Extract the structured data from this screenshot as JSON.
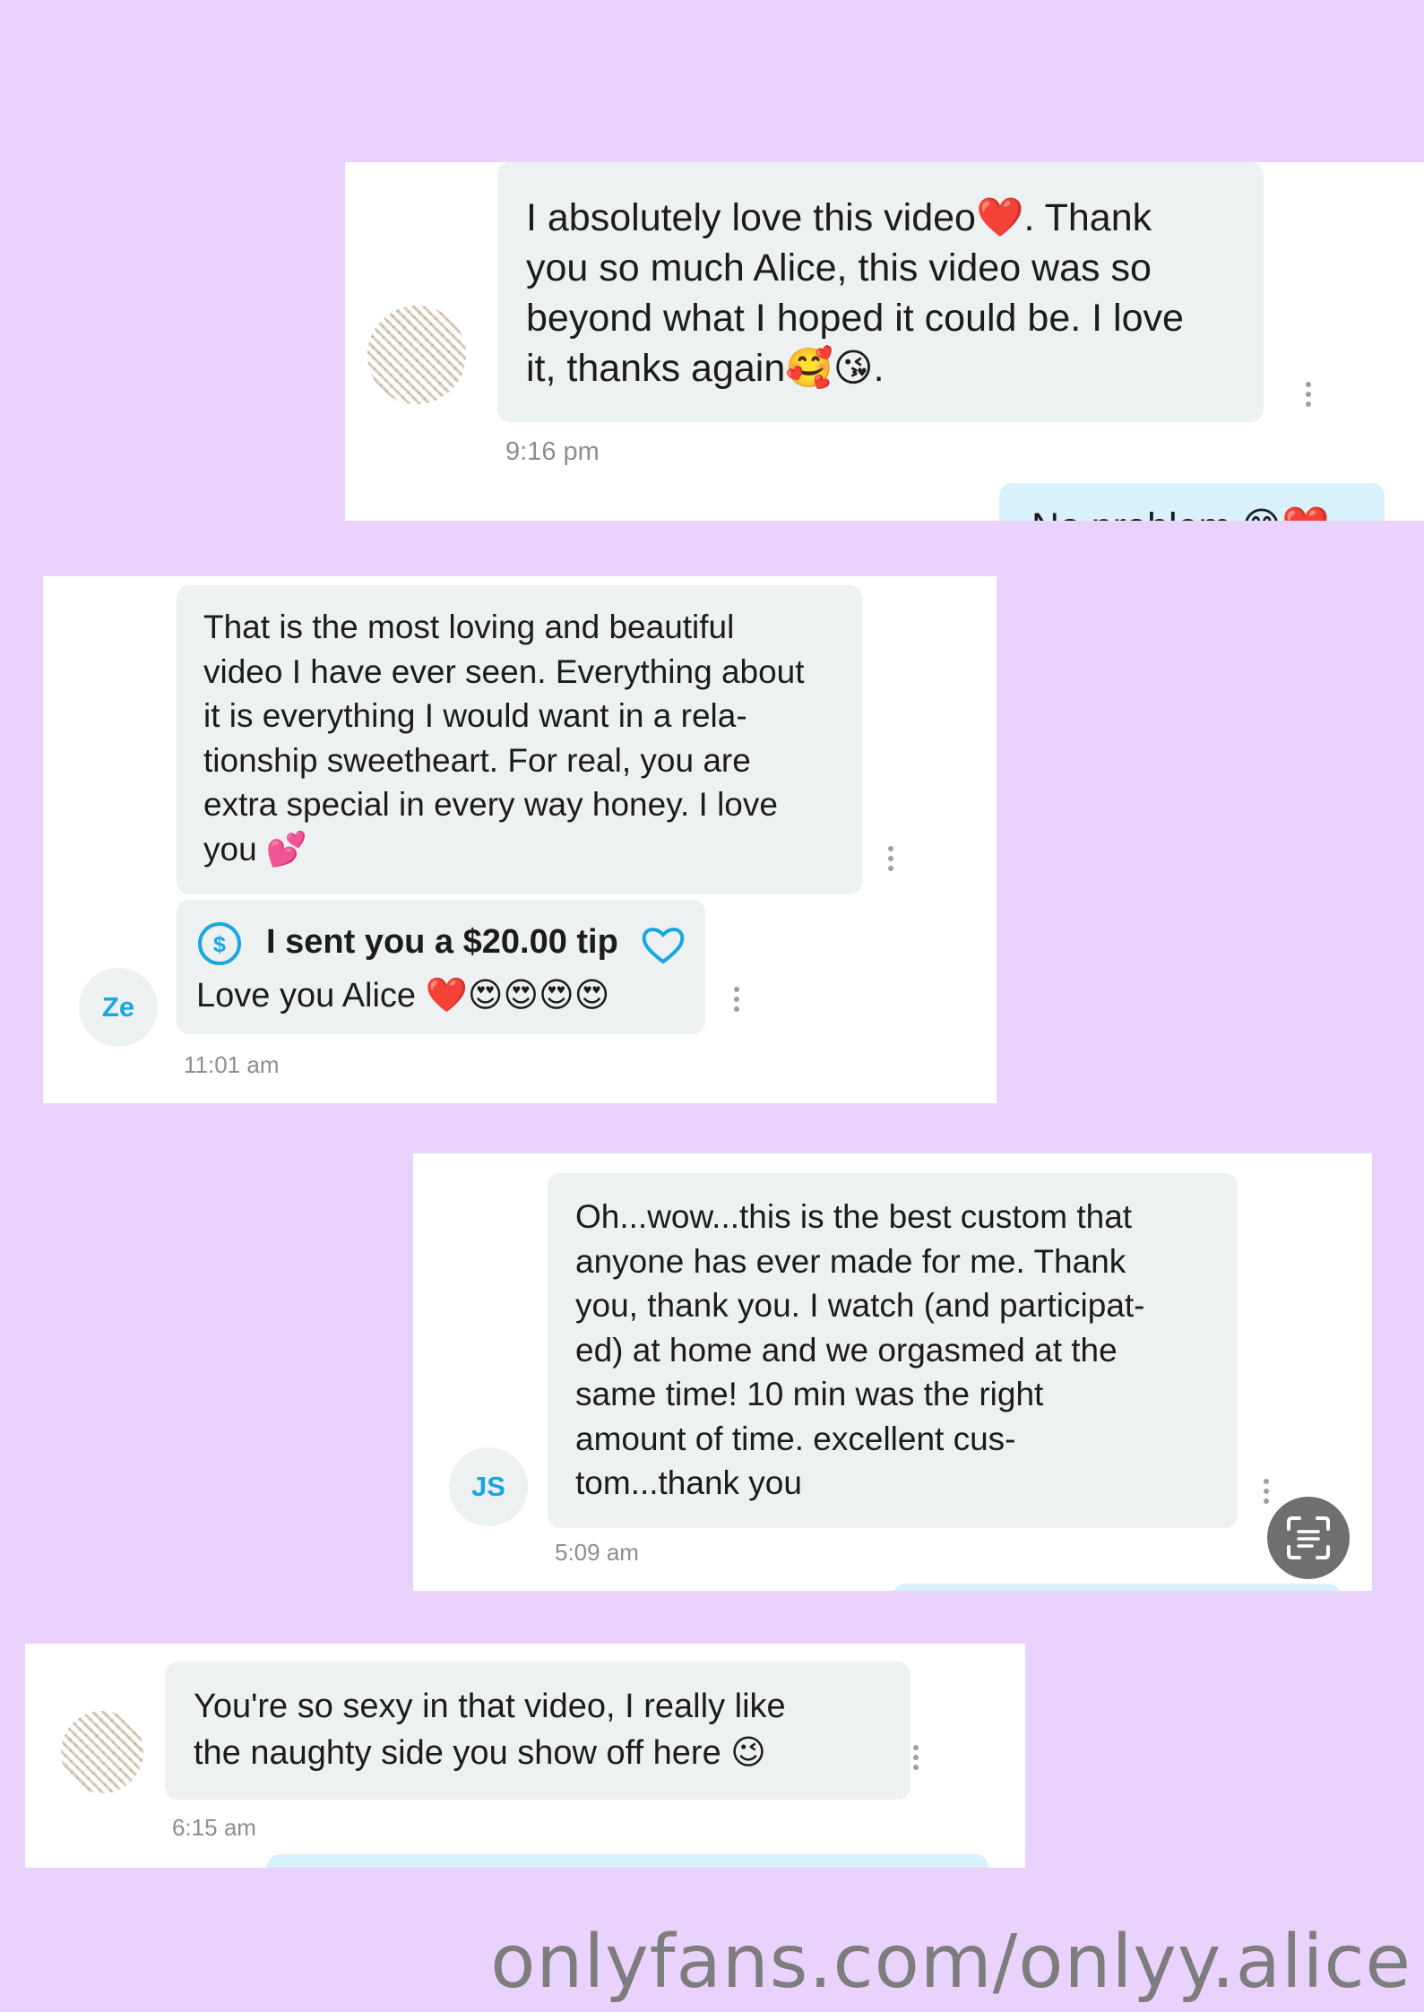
{
  "colors": {
    "background": "#e9d3fc",
    "bubble": "#eef1f2",
    "accent": "#19a7e0",
    "reply_bubble": "#d9f1fb"
  },
  "chat1": {
    "message": "I absolutely love this video❤️. Thank\nyou so much Alice, this video was so\nbeyond what I hoped it could be. I love\nit, thanks again🥰😘.",
    "time": "9:16 pm",
    "reply_peek": "No problem 😊❤️"
  },
  "chat2": {
    "avatar_initials": "Ze",
    "message": "That is the most loving and beautiful\nvideo I have ever seen. Everything about\nit is everything I would want in a rela-\ntionship sweetheart. For real, you are\nextra special in every way honey. I love\nyou 💕",
    "tip_text": "I sent you a $20.00 tip",
    "tip_icon": "dollar-circle-icon",
    "tip_message": "Love you Alice ❤️😍😍😍😍",
    "time": "11:01 am"
  },
  "chat3": {
    "avatar_initials": "JS",
    "message": "Oh...wow...this is the best custom that\nanyone has ever made for me. Thank\nyou, thank you. I watch (and participat-\ned) at home and we orgasmed at the\nsame time! 10 min was the right\namount of time. excellent cus-\ntom...thank you",
    "time": "5:09 am",
    "fab_icon": "text-scan-icon"
  },
  "chat4": {
    "message": "You're so sexy in that video, I really like\nthe naughty side you show off here 😉",
    "time": "6:15 am"
  },
  "watermark": "onlyfans.com/onlyy.alice"
}
